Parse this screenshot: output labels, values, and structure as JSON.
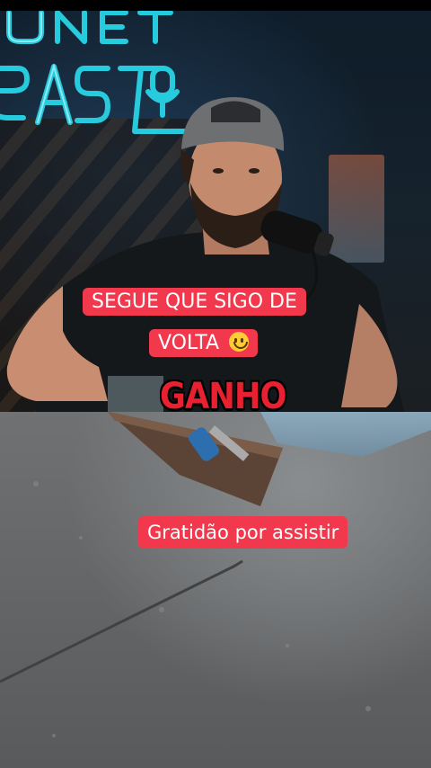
{
  "captions": {
    "line1": "SEGUE QUE SIGO DE",
    "line2": "VOLTA",
    "emoji_icon": "slightly-smiling-face-icon",
    "overlay_word": "GANHO",
    "bottom": "Gratidão por assistir"
  },
  "colors": {
    "caption_bg": "#f2384c",
    "caption_text": "#ffffff",
    "overlay_word": "#e8202f",
    "neon": "#27d4e6"
  }
}
